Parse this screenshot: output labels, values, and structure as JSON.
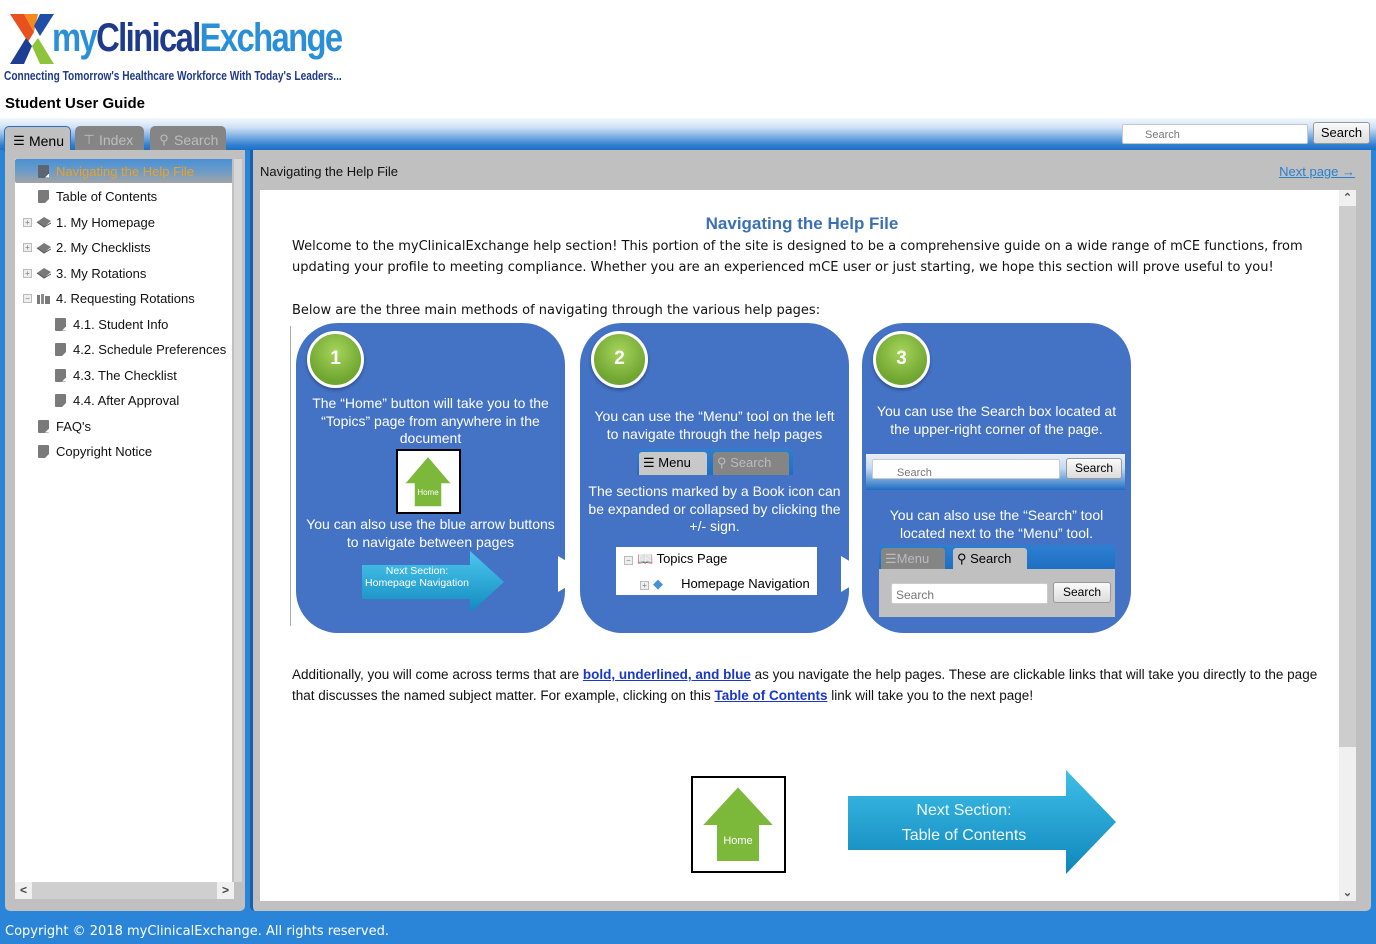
{
  "header": {
    "logo": {
      "my": "my",
      "clinical": "Clinical",
      "exchange": "Exchange"
    },
    "tagline": "Connecting Tomorrow's Healthcare Workforce With Today's Leaders...",
    "guide_title": "Student User Guide"
  },
  "toolbar": {
    "tabs": [
      {
        "label": "Menu",
        "icon": "list-icon",
        "active": true
      },
      {
        "label": "Index",
        "icon": "signpost-icon",
        "active": false
      },
      {
        "label": "Search",
        "icon": "magnifier-icon",
        "active": false
      }
    ],
    "search_placeholder": "Search",
    "search_button": "Search"
  },
  "sidebar": {
    "items": [
      {
        "label": "Navigating the Help File",
        "type": "page",
        "level": 0,
        "selected": true
      },
      {
        "label": "Table of Contents",
        "type": "page",
        "level": 0
      },
      {
        "label": "1. My Homepage",
        "type": "book",
        "level": 0,
        "toggle": "+"
      },
      {
        "label": "2. My Checklists",
        "type": "book",
        "level": 0,
        "toggle": "+"
      },
      {
        "label": "3. My Rotations",
        "type": "book",
        "level": 0,
        "toggle": "+"
      },
      {
        "label": "4. Requesting Rotations",
        "type": "open-book",
        "level": 0,
        "toggle": "-"
      },
      {
        "label": "4.1. Student Info",
        "type": "page",
        "level": 1
      },
      {
        "label": "4.2. Schedule Preferences",
        "type": "page",
        "level": 1
      },
      {
        "label": "4.3. The Checklist",
        "type": "page",
        "level": 1
      },
      {
        "label": "4.4. After Approval",
        "type": "page",
        "level": 1
      },
      {
        "label": "FAQ's",
        "type": "page",
        "level": 0
      },
      {
        "label": "Copyright Notice",
        "type": "page",
        "level": 0
      }
    ],
    "scroll_left": "<",
    "scroll_right": ">"
  },
  "content": {
    "title": "Navigating the Help File",
    "next_page": "Next page →",
    "heading": "Navigating the Help File",
    "intro": "Welcome to the myClinicalExchange help section! This portion of the site is designed to be a comprehensive guide on a wide range of mCE functions, from updating your profile to meeting compliance. Whether you are an experienced mCE user or just starting, we hope this section will prove useful to you!",
    "methods_intro": "Below are the three main methods of navigating through the various help pages:",
    "methods": [
      {
        "number": "1",
        "text1": "The “Home” button will take you to the “Topics” page from anywhere in the document",
        "home_label": "Home",
        "text2": "You can also use the blue arrow buttons to navigate between pages",
        "arrow_label_1": "Next Section:",
        "arrow_label_2": "Homepage Navigation"
      },
      {
        "number": "2",
        "text1": "You can use the “Menu” tool on the left to navigate through the help pages",
        "tab_menu": "Menu",
        "tab_search": "Search",
        "text2": "The sections marked by a Book icon can be expanded or collapsed by clicking the +/- sign.",
        "tree_item_1": "Topics Page",
        "tree_item_2": "Homepage Navigation"
      },
      {
        "number": "3",
        "text1": "You can use the Search box located at the upper-right corner of the page.",
        "search_placeholder": "Search",
        "search_button": "Search",
        "text2": "You can also use the “Search” tool located next to the “Menu” tool.",
        "tab_menu": "Menu",
        "tab_search": "Search",
        "search2_placeholder": "Search",
        "search2_button": "Search"
      }
    ],
    "links_para": {
      "p1": "Additionally, you will come across terms that are ",
      "link1": "bold, underlined, and blue",
      "p2": " as you navigate the help pages. These are clickable links that will take you directly to the page that discusses the named subject matter. For example, clicking on this ",
      "link2": "Table of Contents",
      "p3": " link will take you to the next page!"
    },
    "bottom_nav": {
      "home_label": "Home",
      "next_label_1": "Next Section:",
      "next_label_2": "Table of Contents"
    }
  },
  "footer": {
    "copyright": "Copyright © 2018 myClinicalExchange. All rights reserved."
  },
  "colors": {
    "brand_blue": "#2a85d8",
    "panel_blue": "#4472c4",
    "link_blue": "#1a37c8",
    "selected_text": "#f0a020",
    "green": "#7cb83a"
  }
}
